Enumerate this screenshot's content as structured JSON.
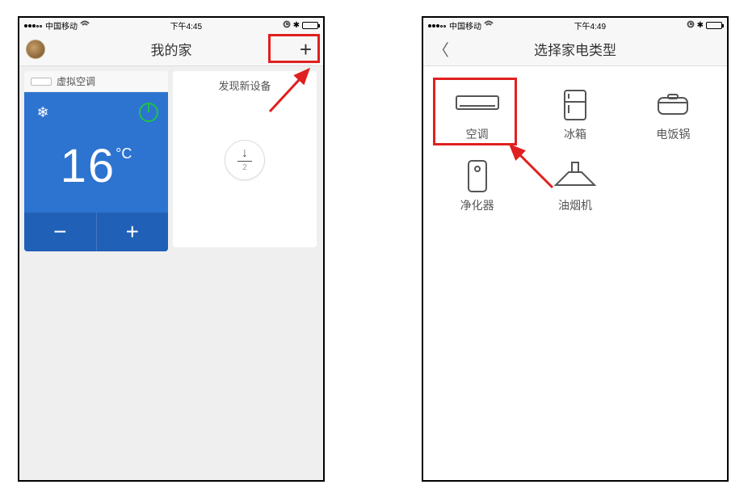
{
  "left": {
    "status": {
      "carrier": "中国移动",
      "time": "下午4:45"
    },
    "nav": {
      "title": "我的家",
      "plus": "+"
    },
    "ac": {
      "name": "虚拟空调",
      "temperature": "16",
      "unit": "°C",
      "minus": "−",
      "plus": "+"
    },
    "discover": {
      "title": "发现新设备",
      "count": "2"
    }
  },
  "right": {
    "status": {
      "carrier": "中国移动",
      "time": "下午4:49"
    },
    "nav": {
      "title": "选择家电类型"
    },
    "tiles": [
      {
        "label": "空调"
      },
      {
        "label": "冰箱"
      },
      {
        "label": "电饭锅"
      },
      {
        "label": "净化器"
      },
      {
        "label": "油烟机"
      }
    ]
  }
}
